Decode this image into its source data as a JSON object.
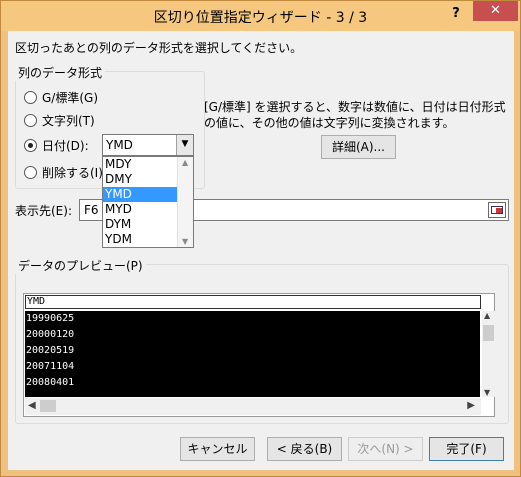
{
  "window": {
    "title": "区切り位置指定ウィザード - 3 / 3",
    "help": "?",
    "close": "✕"
  },
  "instruction": "区切ったあとの列のデータ形式を選択してください。",
  "format_group": {
    "label": "列のデータ形式",
    "options": [
      {
        "label": "G/標準(G)",
        "selected": false
      },
      {
        "label": "文字列(T)",
        "selected": false
      },
      {
        "label": "日付(D):",
        "selected": true
      },
      {
        "label": "削除する(I)",
        "selected": false
      }
    ]
  },
  "date_combo": {
    "value": "YMD",
    "options": [
      "MDY",
      "DMY",
      "YMD",
      "MYD",
      "DYM",
      "YDM"
    ],
    "selected_index": 2
  },
  "description": "[G/標準] を選択すると、数字は数値に、日付は日付形式の値に、その他の値は文字列に変換されます。",
  "advanced_button": "詳細(A)...",
  "destination": {
    "label": "表示先(E):",
    "value": "F6"
  },
  "preview": {
    "label": "データのプレビュー(P)",
    "column_header": "YMD",
    "rows": [
      "19990625",
      "20000120",
      "20020519",
      "20071104",
      "20080401"
    ]
  },
  "buttons": {
    "cancel": "キャンセル",
    "back": "< 戻る(B)",
    "next": "次へ(N) >",
    "finish": "完了(F)"
  },
  "colors": {
    "titlebar": "#f6c87f",
    "close": "#c74f4f",
    "highlight": "#3399ff"
  }
}
